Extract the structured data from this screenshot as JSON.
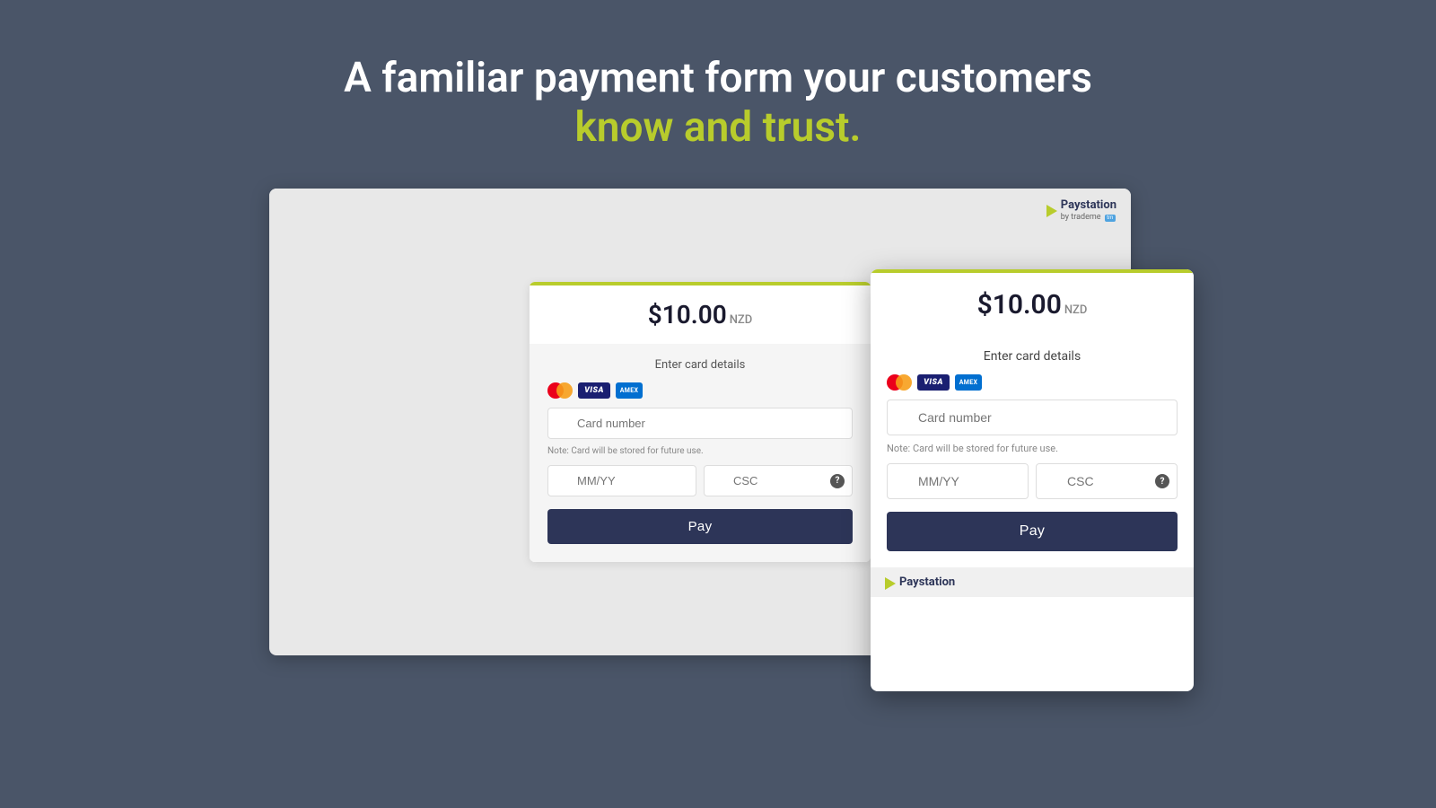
{
  "headline": {
    "line1": "A familiar payment form your customers",
    "line2": "know and trust."
  },
  "desktop_form": {
    "amount": "$10.00",
    "currency": "NZD",
    "title": "Enter card details",
    "card_number_placeholder": "Card number",
    "note": "Note: Card will be stored for future use.",
    "expiry_placeholder": "MM/YY",
    "csc_placeholder": "CSC",
    "pay_button": "Pay",
    "paystation_label": "Paystation",
    "paystation_sub": "by trademe"
  },
  "mobile_form": {
    "amount": "$10.00",
    "currency": "NZD",
    "title": "Enter card details",
    "card_number_placeholder": "Card number",
    "note": "Note: Card will be stored for future use.",
    "expiry_placeholder": "MM/YY",
    "csc_placeholder": "CSC",
    "pay_button": "Pay",
    "paystation_label": "Paystation"
  }
}
